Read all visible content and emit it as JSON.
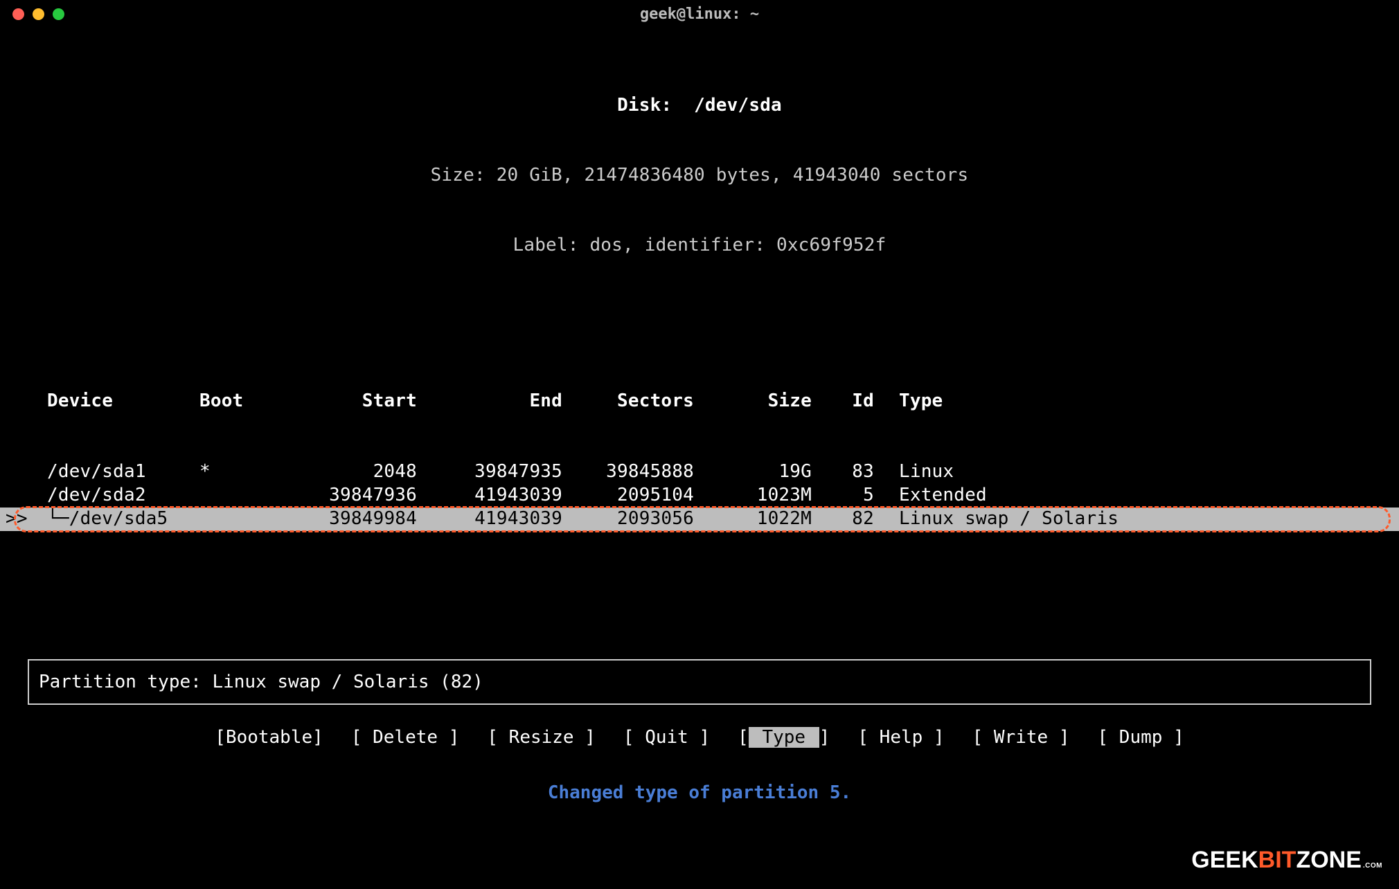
{
  "window": {
    "title": "geek@linux: ~"
  },
  "disk": {
    "label_disk": "Disk:",
    "device": "/dev/sda",
    "size_line": "Size: 20 GiB, 21474836480 bytes, 41943040 sectors",
    "label_line": "Label: dos, identifier: 0xc69f952f"
  },
  "columns": {
    "device": "Device",
    "boot": "Boot",
    "start": "Start",
    "end": "End",
    "sectors": "Sectors",
    "size": "Size",
    "id": "Id",
    "type": "Type"
  },
  "rows": [
    {
      "prefix": "",
      "device": "/dev/sda1",
      "boot": "*",
      "start": "2048",
      "end": "39847935",
      "sectors": "39845888",
      "size": "19G",
      "id": "83",
      "type": "Linux",
      "selected": false,
      "nested": false
    },
    {
      "prefix": "",
      "device": "/dev/sda2",
      "boot": "",
      "start": "39847936",
      "end": "41943039",
      "sectors": "2095104",
      "size": "1023M",
      "id": "5",
      "type": "Extended",
      "selected": false,
      "nested": false
    },
    {
      "prefix": ">>",
      "device": "/dev/sda5",
      "boot": "",
      "start": "39849984",
      "end": "41943039",
      "sectors": "2093056",
      "size": "1022M",
      "id": "82",
      "type": "Linux swap / Solaris",
      "selected": true,
      "nested": true
    }
  ],
  "info": {
    "text": "Partition type: Linux swap / Solaris (82)"
  },
  "menu": [
    {
      "label": "Bootable",
      "selected": false
    },
    {
      "label": "Delete",
      "selected": false
    },
    {
      "label": "Resize",
      "selected": false
    },
    {
      "label": "Quit",
      "selected": false
    },
    {
      "label": "Type",
      "selected": true
    },
    {
      "label": "Help",
      "selected": false
    },
    {
      "label": "Write",
      "selected": false
    },
    {
      "label": "Dump",
      "selected": false
    }
  ],
  "status": {
    "text": "Changed type of partition 5."
  },
  "watermark": {
    "part1": "GEEK",
    "part2": "BIT",
    "part3": "ZONE",
    "dotcom": ".COM"
  },
  "tree_glyph": "└─"
}
